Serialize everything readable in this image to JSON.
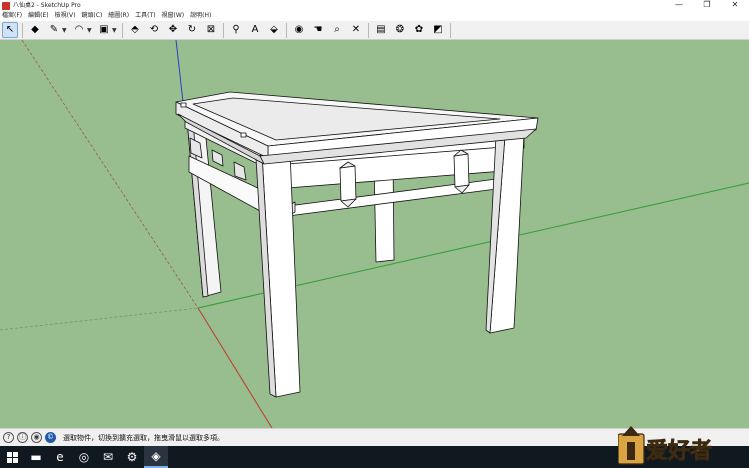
{
  "window": {
    "title": "八仙桌2 - SketchUp Pro",
    "minimize": "—",
    "maximize": "❐",
    "close": "✕"
  },
  "menu": {
    "items": [
      {
        "label": "檔案(F)"
      },
      {
        "label": "編輯(E)"
      },
      {
        "label": "檢視(V)"
      },
      {
        "label": "鏡頭(C)"
      },
      {
        "label": "繪圖(R)"
      },
      {
        "label": "工具(T)"
      },
      {
        "label": "視窗(W)"
      },
      {
        "label": "說明(H)"
      }
    ]
  },
  "toolbar": {
    "tools": [
      {
        "name": "select-tool",
        "glyph": "↖",
        "active": true
      },
      {
        "name": "eraser-tool",
        "glyph": "◆"
      },
      {
        "name": "pencil-line-tool",
        "glyph": "✎",
        "dropdown": true
      },
      {
        "name": "arc-tool",
        "glyph": "◠",
        "dropdown": true
      },
      {
        "name": "rectangle-tool",
        "glyph": "▣",
        "dropdown": true
      },
      {
        "name": "push-pull-tool",
        "glyph": "⬘"
      },
      {
        "name": "offset-tool",
        "glyph": "⟲"
      },
      {
        "name": "move-tool",
        "glyph": "✥"
      },
      {
        "name": "rotate-tool",
        "glyph": "↻"
      },
      {
        "name": "scale-tool",
        "glyph": "⊠"
      },
      {
        "name": "tape-measure-tool",
        "glyph": "⚲"
      },
      {
        "name": "text-tool",
        "glyph": "A"
      },
      {
        "name": "paint-bucket-tool",
        "glyph": "⬙"
      },
      {
        "name": "orbit-tool",
        "glyph": "◉"
      },
      {
        "name": "pan-tool",
        "glyph": "☚"
      },
      {
        "name": "zoom-tool",
        "glyph": "⌕"
      },
      {
        "name": "zoom-extents-tool",
        "glyph": "✕"
      },
      {
        "name": "warehouse-tool",
        "glyph": "▤"
      },
      {
        "name": "extension-warehouse-tool",
        "glyph": "❂"
      },
      {
        "name": "extension-tool",
        "glyph": "✿"
      },
      {
        "name": "layout-tool",
        "glyph": "◩"
      }
    ]
  },
  "statusbar": {
    "icons": [
      {
        "name": "help-icon",
        "glyph": "?"
      },
      {
        "name": "info-icon",
        "glyph": "ⓘ"
      },
      {
        "name": "user-icon",
        "glyph": "◉"
      },
      {
        "name": "instructor-icon",
        "glyph": "©"
      }
    ],
    "message": "選取物件，切換到擴充選取，拖曳滑鼠以選取多項。"
  },
  "taskbar": {
    "items": [
      {
        "name": "start-button",
        "glyph": ""
      },
      {
        "name": "file-explorer-icon",
        "glyph": "▬"
      },
      {
        "name": "edge-icon",
        "glyph": "e"
      },
      {
        "name": "chrome-icon",
        "glyph": "◎"
      },
      {
        "name": "outlook-icon",
        "glyph": "✉"
      },
      {
        "name": "settings-icon",
        "glyph": "⚙"
      },
      {
        "name": "sketchup-icon",
        "glyph": "◈"
      }
    ]
  },
  "watermark": {
    "text": "爱好者"
  },
  "colors": {
    "viewport_bg": "#98bd8e",
    "axis_red": "#c0392b",
    "axis_green": "#2f9e36",
    "axis_blue": "#2b3fc7",
    "model_face": "#ffffff",
    "model_shade": "#d8d8d8",
    "model_edge": "#111111"
  }
}
